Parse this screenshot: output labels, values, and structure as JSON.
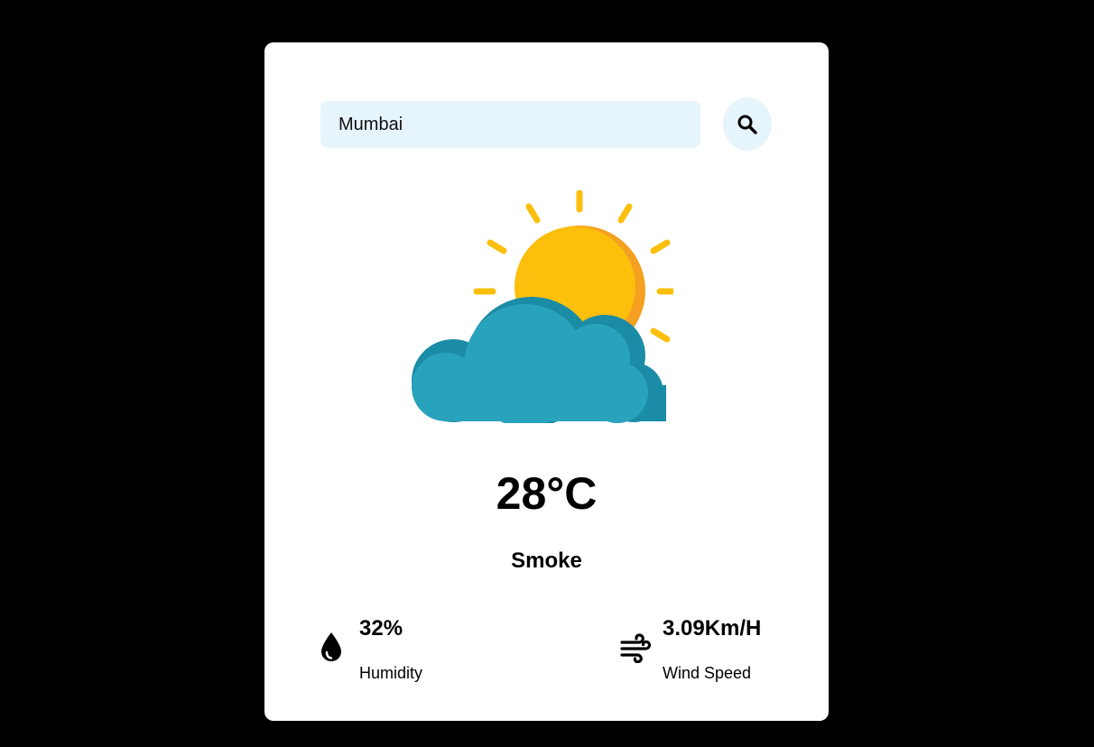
{
  "search": {
    "value": "Mumbai",
    "placeholder": "",
    "button_icon": "search-icon"
  },
  "weather": {
    "icon": "sun-behind-cloud-icon",
    "temperature": "28°C",
    "condition": "Smoke"
  },
  "stats": {
    "humidity": {
      "icon": "water-drop-icon",
      "value": "32%",
      "label": "Humidity"
    },
    "wind": {
      "icon": "wind-icon",
      "value": "3.09Km/H",
      "label": "Wind Speed"
    }
  },
  "colors": {
    "background": "#000000",
    "card": "#ffffff",
    "input_bg": "#e6f4fb",
    "sun": "#fbbf0c",
    "sun_shade": "#f5a020",
    "cloud": "#29a3bb",
    "cloud_shade": "#1b8ca5"
  }
}
